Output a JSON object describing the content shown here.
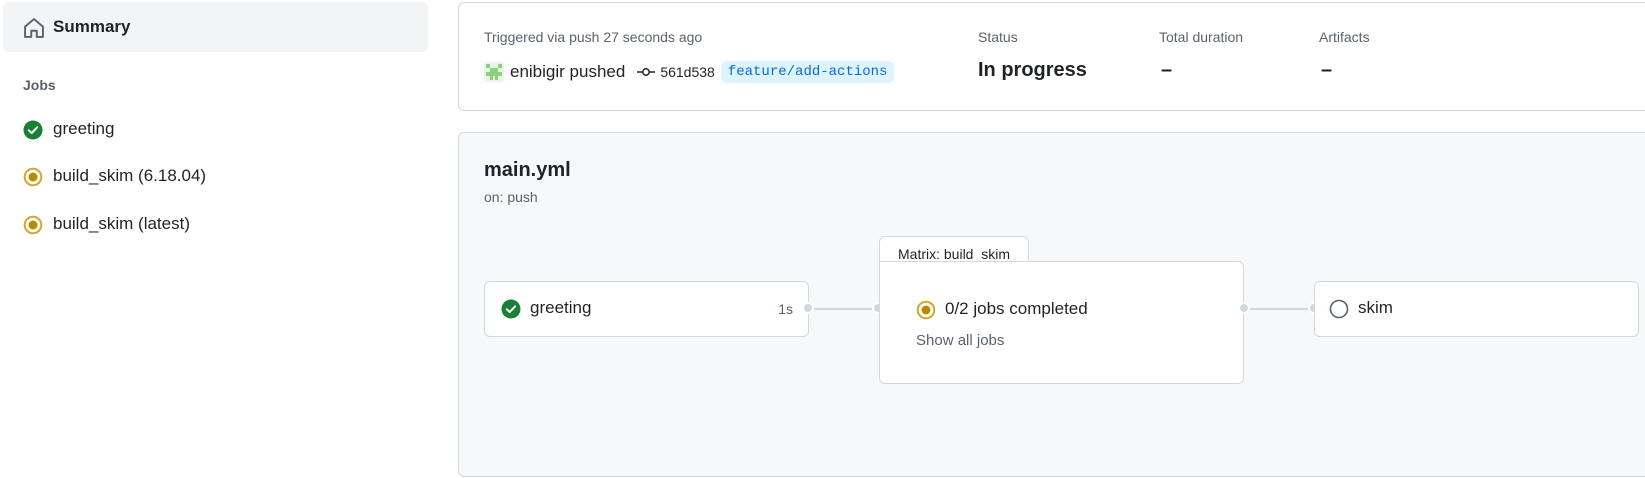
{
  "sidebar": {
    "summary_label": "Summary",
    "jobs_heading": "Jobs",
    "jobs": [
      {
        "label": "greeting",
        "status": "success"
      },
      {
        "label": "build_skim (6.18.04)",
        "status": "in_progress"
      },
      {
        "label": "build_skim (latest)",
        "status": "in_progress"
      }
    ]
  },
  "run": {
    "trigger_text": "Triggered via push 27 seconds ago",
    "actor": "enibigir pushed",
    "commit_sha": "561d538",
    "branch": "feature/add-actions",
    "status_label": "Status",
    "status_value": "In progress",
    "duration_label": "Total duration",
    "duration_value": "–",
    "artifacts_label": "Artifacts",
    "artifacts_value": "–"
  },
  "workflow": {
    "file": "main.yml",
    "trigger": "on: push",
    "nodes": {
      "greeting": {
        "name": "greeting",
        "duration": "1s",
        "status": "success"
      },
      "matrix": {
        "tab_label": "Matrix: build_skim",
        "progress_text": "0/2 jobs completed",
        "show_all_label": "Show all jobs",
        "status": "in_progress"
      },
      "skim": {
        "name": "skim",
        "status": "queued"
      }
    }
  },
  "colors": {
    "success": "#1a7f37",
    "in_progress": "#bf8700",
    "queued": "#59636e",
    "link": "#0969da"
  },
  "icons": {
    "summary": "home-icon",
    "success": "check-circle-icon",
    "in_progress": "dot-fill-icon",
    "queued": "circle-outline-icon",
    "commit": "git-commit-icon"
  }
}
